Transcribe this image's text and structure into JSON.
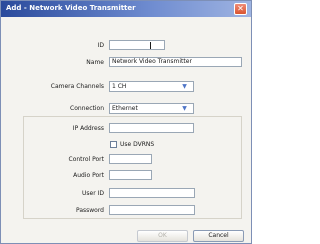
{
  "window": {
    "title": "Add - Network Video Transmitter",
    "close_glyph": "✕"
  },
  "form": {
    "id": {
      "label": "ID",
      "value": ""
    },
    "name": {
      "label": "Name",
      "value": "Network Video Transmitter"
    },
    "camera_channels": {
      "label": "Camera Channels",
      "value": "1 CH"
    },
    "connection": {
      "label": "Connection",
      "value": "Ethernet"
    },
    "ip_address": {
      "label": "IP Address",
      "value": ""
    },
    "use_dvrns": {
      "label": "Use DVRNS",
      "checked": false
    },
    "control_port": {
      "label": "Control Port",
      "value": ""
    },
    "audio_port": {
      "label": "Audio Port",
      "value": ""
    },
    "user_id": {
      "label": "User ID",
      "value": ""
    },
    "password": {
      "label": "Password",
      "value": ""
    }
  },
  "buttons": {
    "ok": {
      "label": "OK",
      "enabled": false
    },
    "cancel": {
      "label": "Cancel",
      "enabled": true
    }
  },
  "icons": {
    "dropdown": "chevron-down-icon",
    "close": "close-icon"
  },
  "colors": {
    "title_bar": "#2a4a9c",
    "close_button": "#d9542f",
    "chevron": "#4f75c7"
  }
}
